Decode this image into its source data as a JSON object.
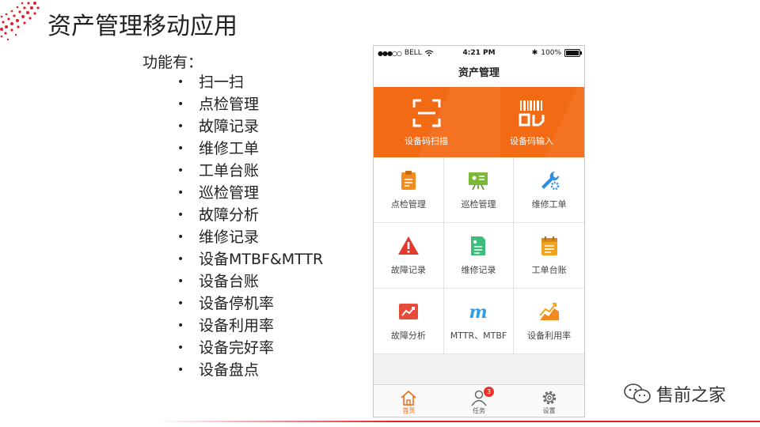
{
  "slide": {
    "title": "资产管理移动应用",
    "features_label": "功能有：",
    "features": [
      "扫一扫",
      "点检管理",
      "故障记录",
      "维修工单",
      "工单台账",
      "巡检管理",
      "故障分析",
      "维修记录",
      "设备MTBF&MTTR",
      "设备台账",
      "设备停机率",
      "设备利用率",
      "设备完好率",
      "设备盘点"
    ]
  },
  "phone": {
    "status_bar": {
      "carrier": "BELL",
      "time": "4:21 PM",
      "battery": "100%"
    },
    "nav_title": "资产管理",
    "hero": [
      {
        "label": "设备码扫描",
        "icon": "scan-frame-icon"
      },
      {
        "label": "设备码输入",
        "icon": "barcode-icon"
      }
    ],
    "grid": [
      {
        "label": "点检管理",
        "icon": "clipboard-icon",
        "color": "#f28a1e"
      },
      {
        "label": "巡检管理",
        "icon": "presentation-board-icon",
        "color": "#7cb83a"
      },
      {
        "label": "维修工单",
        "icon": "wrench-gear-icon",
        "color": "#2f8fe0"
      },
      {
        "label": "故障记录",
        "icon": "warning-triangle-icon",
        "color": "#e23a2e"
      },
      {
        "label": "维修记录",
        "icon": "document-icon",
        "color": "#3dbd7d"
      },
      {
        "label": "工单台账",
        "icon": "ledger-icon",
        "color": "#f2a31e"
      },
      {
        "label": "故障分析",
        "icon": "trend-chart-icon",
        "color": "#e84a3a"
      },
      {
        "label": "MTTR、MTBF",
        "icon": "m-letter-icon",
        "color": "#2f9ee8"
      },
      {
        "label": "设备利用率",
        "icon": "area-chart-icon",
        "color": "#f28a1e"
      }
    ],
    "tabs": [
      {
        "label": "首页",
        "icon": "home-icon",
        "active": true
      },
      {
        "label": "任务",
        "icon": "user-icon",
        "badge": "3"
      },
      {
        "label": "设置",
        "icon": "gear-icon"
      }
    ],
    "accent_color": "#f26a14"
  },
  "brand": {
    "name": "售前之家"
  }
}
